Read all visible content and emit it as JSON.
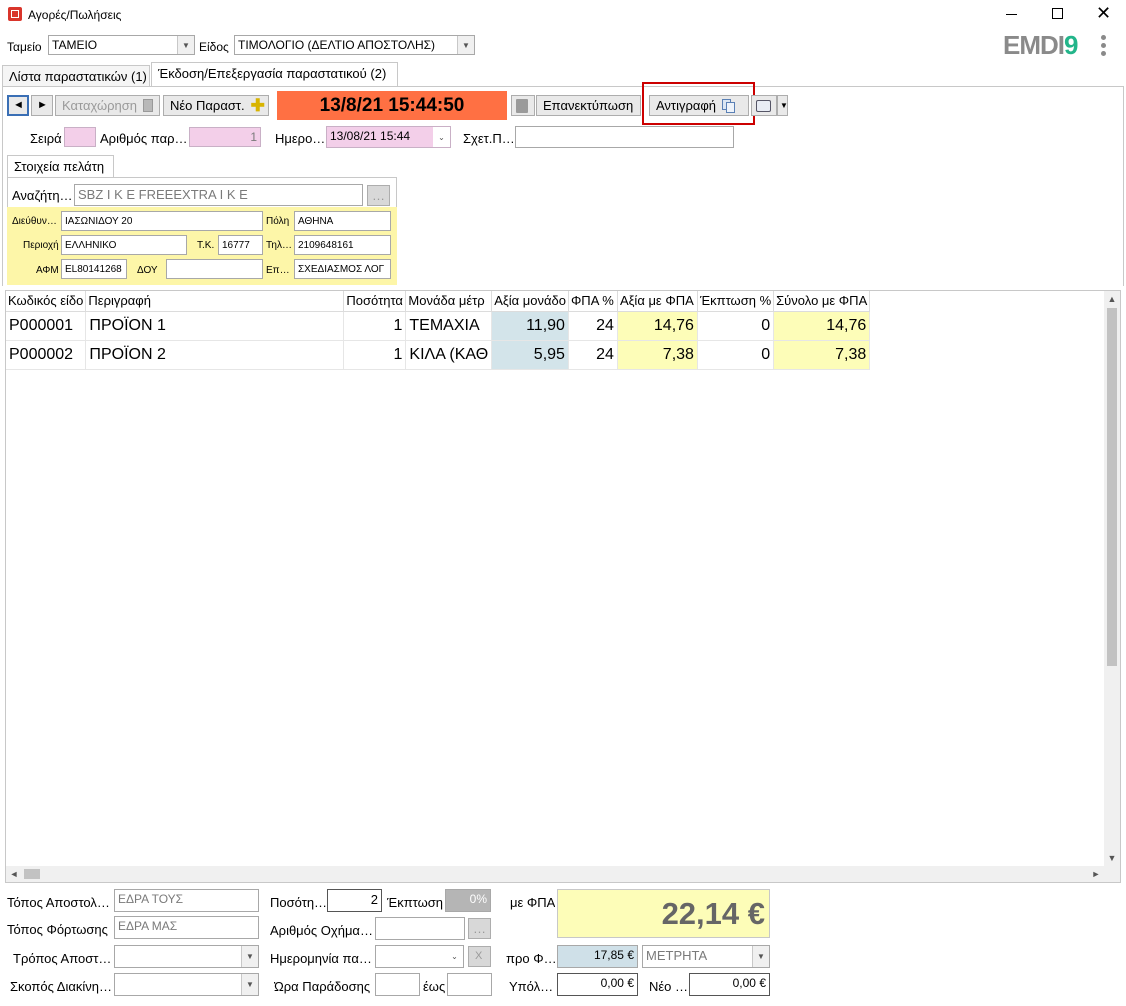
{
  "window": {
    "title": "Αγορές/Πωλήσεις",
    "min_icon": "minimize-icon",
    "max_icon": "maximize-icon",
    "close_icon": "close-icon"
  },
  "top": {
    "tameio_label": "Ταμείο",
    "tameio_value": "ΤΑΜΕΙΟ",
    "eidos_label": "Είδος",
    "eidos_value": "ΤΙΜΟΛΟΓΙΟ (ΔΕΛΤΙΟ ΑΠΟΣΤΟΛΗΣ)",
    "brand": "EMDI9",
    "brand_accent": "#23b58a"
  },
  "tabs": [
    {
      "label": "Λίστα παραστατικών (1)"
    },
    {
      "label": "Έκδοση/Επεξεργασία παραστατικού (2)"
    }
  ],
  "toolbar": {
    "prev_glyph": "◄",
    "next_glyph": "►",
    "save_label": "Καταχώρηση",
    "new_label": "Νέο Παραστ.",
    "datetime": "13/8/21 15:44:50",
    "reprint_label": "Επανεκτύπωση",
    "copy_label": "Αντιγραφή",
    "datetime_color": "#ff7043",
    "highlight_color": "#cc0000"
  },
  "header": {
    "seira_label": "Σειρά",
    "arithmos_label": "Αριθμός παρ…",
    "arithmos_value": "1",
    "hmero_label": "Ημερο…",
    "hmero_value": "13/08/21 15:44",
    "sxet_label": "Σχετ.Π…"
  },
  "customer": {
    "tab_label": "Στοιχεία πελάτη",
    "search_label": "Αναζήτη…",
    "search_value": "SBZ I K E  FREEEXTRA I K E",
    "search_btn": "…",
    "address_label": "Διεύθυν…",
    "address_value": "ΙΑΣΩΝΙΔΟΥ 20",
    "city_label": "Πόλη",
    "city_value": "ΑΘΗΝΑ",
    "area_label": "Περιοχή",
    "area_value": "ΕΛΛΗΝΙΚΟ",
    "tk_label": "Τ.Κ.",
    "tk_value": "16777",
    "tel_label": "Τηλ…",
    "tel_value": "2109648161",
    "afm_label": "ΑΦΜ",
    "afm_value": "EL80141268",
    "doy_label": "ΔΟΥ",
    "doy_value": "",
    "ep_label": "Επ…",
    "ep_value": "ΣΧΕΔΙΑΣΜΟΣ ΛΟΓ"
  },
  "grid": {
    "columns": [
      "Κωδικός είδο",
      "Περιγραφή",
      "Ποσότητα",
      "Μονάδα μέτρ",
      "Αξία μονάδο",
      "ΦΠΑ %",
      "Αξία με ΦΠΑ",
      "Έκπτωση %",
      "Σύνολο με ΦΠΑ"
    ],
    "rows": [
      [
        "P000001",
        "ΠΡΟΪΟΝ 1",
        "1",
        "ΤΕΜΑΧΙΑ",
        "11,90",
        "24",
        "14,76",
        "0",
        "14,76"
      ],
      [
        "P000002",
        "ΠΡΟΪΟΝ 2",
        "1",
        "ΚΙΛΑ (ΚΑΘ",
        "5,95",
        "24",
        "7,38",
        "0",
        "7,38"
      ]
    ]
  },
  "footer": {
    "topos_apostolis_label": "Τόπος Αποστολ…",
    "topos_apostolis_value": "ΕΔΡΑ ΤΟΥΣ",
    "topos_fortosis_label": "Τόπος Φόρτωσης",
    "topos_fortosis_value": "ΕΔΡΑ ΜΑΣ",
    "tropos_label": "Τρόπος Αποστ…",
    "skopos_label": "Σκοπός Διακίνη…",
    "posot_label": "Ποσότη…",
    "posot_value": "2",
    "ekptosi_label": "Έκπτωση",
    "ekptosi_value": "0%",
    "oxima_label": "Αριθμός Οχήμα…",
    "oxima_btn": "…",
    "hmer_label": "Ημερομηνία πα…",
    "x_btn": "X",
    "ora_label": "Ώρα Παράδοσης",
    "eos_label": "έως",
    "fpa_label": "με ΦΠΑ",
    "total": "22,14 €",
    "pro_label": "προ Φ…",
    "pro_value": "17,85 €",
    "payment_value": "ΜΕΤΡΗΤΑ",
    "ypol_label": "Υπόλ…",
    "ypol_value": "0,00 €",
    "neo_label": "Νέο …",
    "neo_value": "0,00 €"
  }
}
